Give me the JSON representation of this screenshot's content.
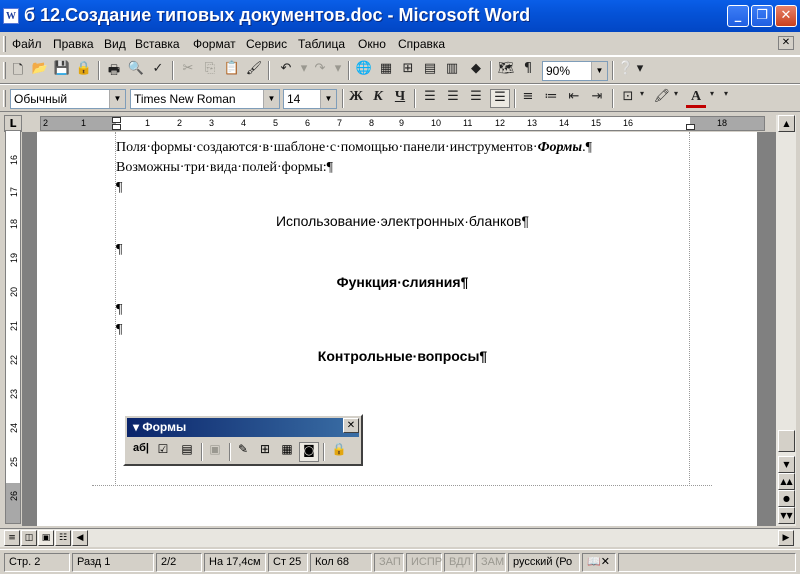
{
  "window": {
    "app_icon": "W",
    "title": "б  12.Создание типовых документов.doc - Microsoft Word",
    "minimize": "_",
    "maximize": "❐",
    "close": "✕"
  },
  "menu": {
    "items": [
      "Файл",
      "Правка",
      "Вид",
      "Вставка",
      "Формат",
      "Сервис",
      "Таблица",
      "Окно",
      "Справка"
    ],
    "doc_close": "✕"
  },
  "standard_toolbar": {
    "zoom": "90%",
    "icons": [
      "new-icon",
      "open-icon",
      "save-icon",
      "permission-icon",
      "print-icon",
      "print-preview-icon",
      "spelling-icon",
      "cut-icon",
      "copy-icon",
      "paste-icon",
      "format-painter-icon",
      "undo-icon",
      "redo-icon",
      "hyperlink-icon",
      "tables-borders-icon",
      "insert-table-icon",
      "insert-excel-icon",
      "columns-icon",
      "drawing-icon",
      "document-map-icon",
      "show-formatting-icon",
      "help-icon"
    ]
  },
  "formatting_toolbar": {
    "style": "Обычный",
    "font": "Times New Roman",
    "size": "14",
    "bold_label": "Ж",
    "italic_label": "К",
    "underline_label": "Ч",
    "font_color_label": "A"
  },
  "ruler": {
    "corner": "L",
    "h_numbers": [
      "2",
      "1",
      "1",
      "2",
      "3",
      "4",
      "5",
      "6",
      "7",
      "8",
      "9",
      "10",
      "11",
      "12",
      "13",
      "14",
      "15",
      "16",
      "18"
    ],
    "v_numbers": [
      "16",
      "17",
      "18",
      "19",
      "20",
      "21",
      "22",
      "23",
      "24",
      "25",
      "26"
    ]
  },
  "document": {
    "line1_text": "Поля·формы·создаются·в·шаблоне·с·помощью·панели·инструментов·",
    "line1_emph": "Формы",
    "line1_end": ".¶",
    "line2": "Возможны·три·вида·полей·формы:¶",
    "para_mark": "¶",
    "heading1": "Использование·электронных·бланков¶",
    "heading2": "Функция·слияния¶",
    "heading3": "Контрольные·вопросы¶"
  },
  "forms_toolbar": {
    "title": "Формы",
    "close": "✕",
    "text_field_label": "аб|",
    "checkbox_label": "☑"
  },
  "status": {
    "page": "Стр. 2",
    "section": "Разд 1",
    "pages": "2/2",
    "position": "На 17,4см",
    "line": "Ст 25",
    "column": "Кол 68",
    "rec": "ЗАП",
    "trk": "ИСПР",
    "ext": "ВДЛ",
    "ovr": "ЗАМ",
    "language": "русский (Ро"
  }
}
